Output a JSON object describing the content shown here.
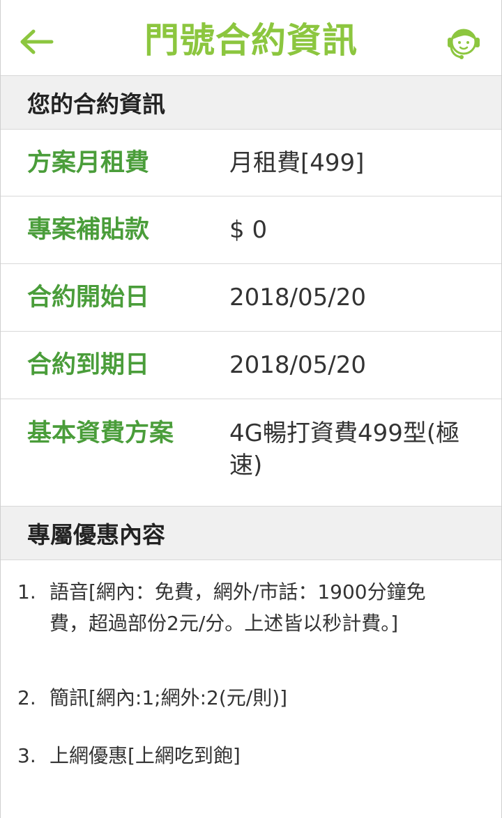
{
  "header": {
    "title": "門號合約資訊",
    "back_icon": "arrow-left-icon",
    "support_icon": "customer-service-agent-icon",
    "accent_color": "#8cc63f"
  },
  "contract": {
    "section_title": "您的合約資訊",
    "rows": [
      {
        "label": "方案月租費",
        "value": "月租費[499]"
      },
      {
        "label": "專案補貼款",
        "value": "$ 0"
      },
      {
        "label": "合約開始日",
        "value": "2018/05/20"
      },
      {
        "label": "合約到期日",
        "value": "2018/05/20"
      },
      {
        "label": "基本資費方案",
        "value": "4G暢打資費499型(極速)"
      }
    ],
    "label_color": "#4a9d3a"
  },
  "promotions": {
    "section_title": "專屬優惠內容",
    "items": [
      {
        "num": "1.",
        "text": "語音[網內：免費，網外/市話：1900分鐘免費，超過部份2元/分。上述皆以秒計費。]"
      },
      {
        "num": "2.",
        "text": "簡訊[網內:1;網外:2(元/則)]"
      },
      {
        "num": "3.",
        "text": "上網優惠[上網吃到飽]"
      }
    ]
  }
}
